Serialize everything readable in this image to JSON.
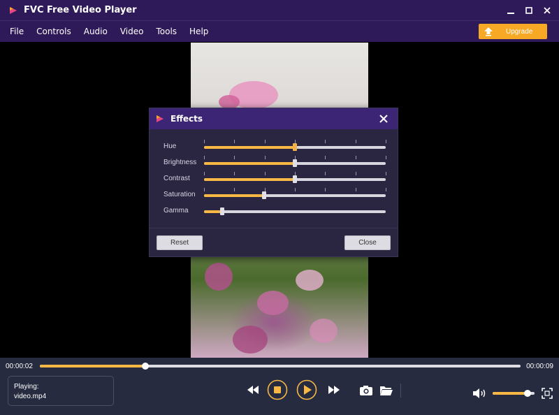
{
  "app": {
    "title": "FVC Free Video Player",
    "logo_icon": "play-triangle-icon"
  },
  "menu": {
    "items": [
      "File",
      "Controls",
      "Audio",
      "Video",
      "Tools",
      "Help"
    ],
    "upgrade_label": "Upgrade",
    "upgrade_color": "#f7a825"
  },
  "effects": {
    "title": "Effects",
    "sliders": [
      {
        "label": "Hue",
        "value": 0.5
      },
      {
        "label": "Brightness",
        "value": 0.5
      },
      {
        "label": "Contrast",
        "value": 0.5
      },
      {
        "label": "Saturation",
        "value": 0.33
      },
      {
        "label": "Gamma",
        "value": 0.1
      }
    ],
    "reset_label": "Reset",
    "close_label": "Close"
  },
  "player": {
    "current_time": "00:00:02",
    "total_time": "00:00:09",
    "progress": 0.22,
    "playing_label": "Playing:",
    "file_name": "video.mp4",
    "volume": 0.84,
    "accent_color": "#f7b845"
  }
}
